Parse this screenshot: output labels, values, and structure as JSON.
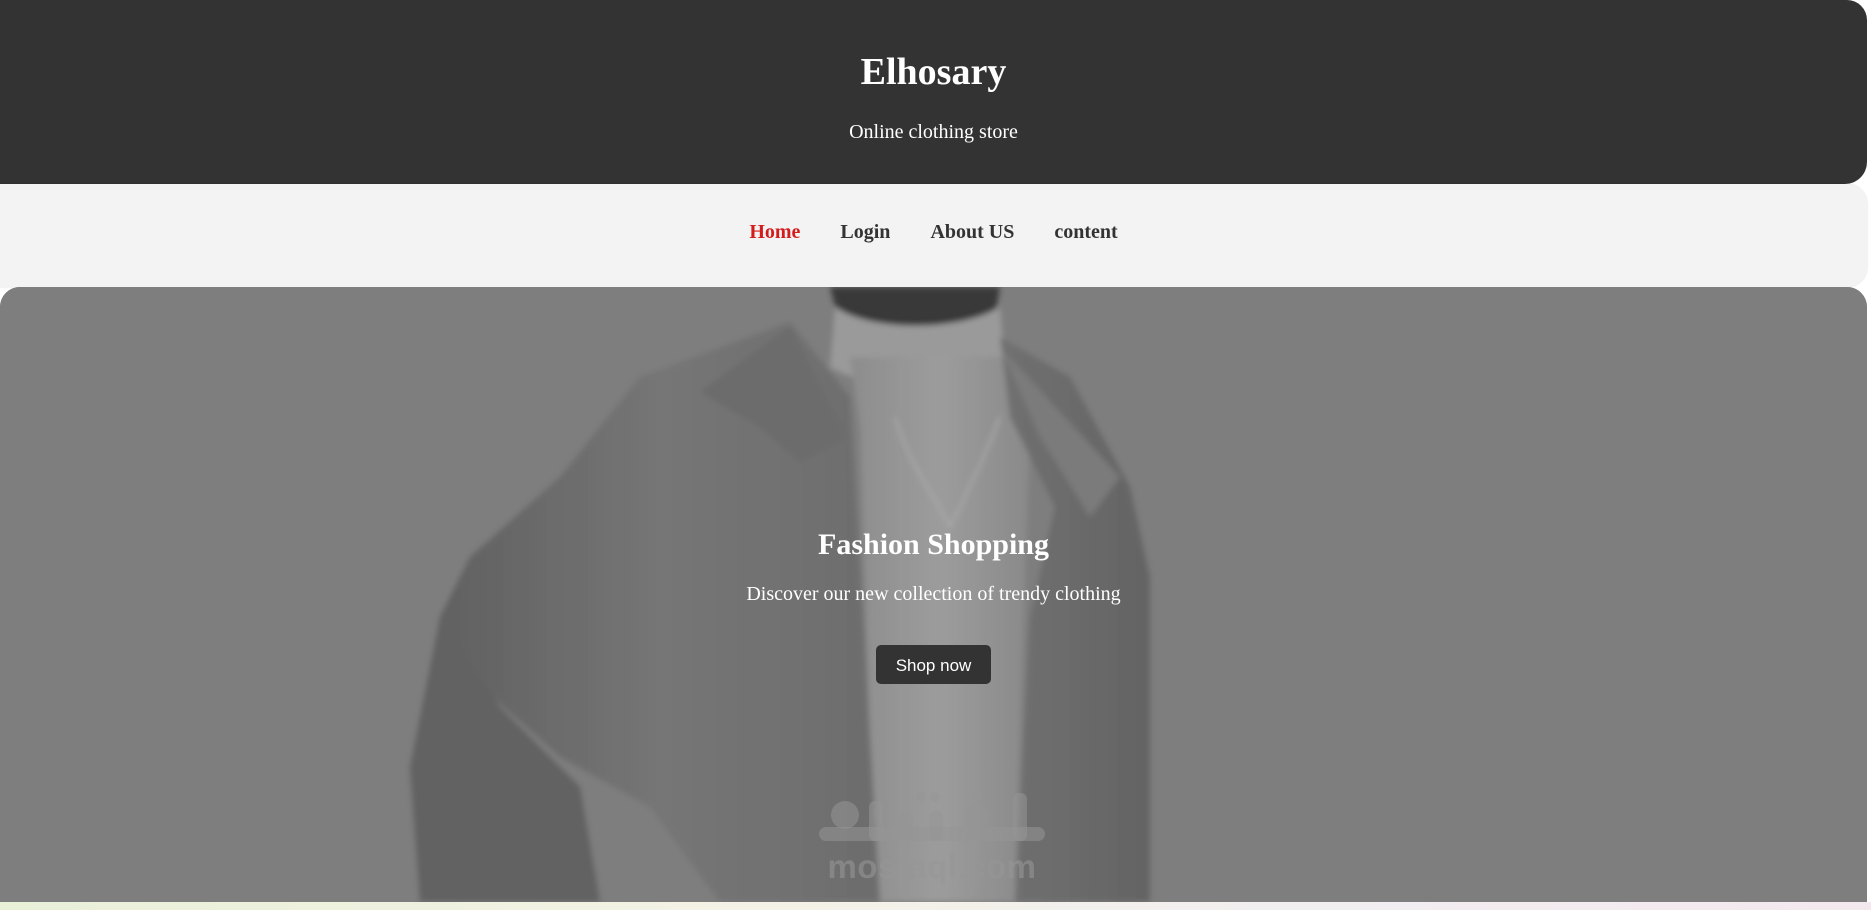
{
  "header": {
    "title": "Elhosary",
    "tagline": "Online clothing store"
  },
  "nav": {
    "items": [
      {
        "label": "Home",
        "active": true
      },
      {
        "label": "Login",
        "active": false
      },
      {
        "label": "About US",
        "active": false
      },
      {
        "label": "content",
        "active": false
      }
    ],
    "active_color": "#d41c1c"
  },
  "hero": {
    "title": "Fashion Shopping",
    "text": "Discover our new collection of trendy clothing",
    "button_label": "Shop now"
  },
  "watermark": {
    "text": "mostaql.com"
  },
  "colors": {
    "header_bg": "#333333",
    "nav_bg": "#f3f3f3",
    "hero_overlay": "#7d7d7d",
    "button_bg": "#333333"
  }
}
